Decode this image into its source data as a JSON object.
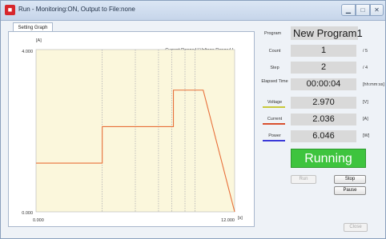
{
  "window": {
    "title": "Run - Monitoring:ON, Output to File:none",
    "icon": "app-red-icon"
  },
  "tab": {
    "label": "Setting Graph"
  },
  "graph": {
    "y_unit": "[A]",
    "y_max_label": "4.000",
    "y_min_label": "0.000",
    "x_min_label": "0.000",
    "x_max_label": "12.000",
    "x_unit": "[s]",
    "range_label": "Current Range:H,Voltage Range:H",
    "line_color": "#e8703a",
    "step_boundaries": [
      4.0,
      6.0,
      7.4,
      8.2,
      9.0,
      9.6
    ],
    "series": [
      {
        "x": [
          0,
          4.0,
          4.0,
          8.3,
          8.3,
          10.1,
          12.0
        ],
        "y": [
          1.2,
          1.2,
          2.1,
          2.1,
          3.0,
          3.0,
          0
        ]
      }
    ],
    "x_range": [
      0,
      12
    ],
    "y_range": [
      0,
      4
    ]
  },
  "status": {
    "program_label": "Program",
    "program_name": "New Program1",
    "count_label": "Count",
    "count_value": "1",
    "count_total": "/ 5",
    "step_label": "Step",
    "step_value": "2",
    "step_total": "/ 4",
    "elapsed_label": "Elapsed Time",
    "elapsed_value": "00:00:04",
    "elapsed_unit": "[hh:mm:ss]",
    "voltage_label": "Voltage",
    "voltage_value": "2.970",
    "voltage_unit": "[V]",
    "voltage_color": "#c9c93a",
    "current_label": "Current",
    "current_value": "2.036",
    "current_unit": "[A]",
    "current_color": "#d9502f",
    "power_label": "Power",
    "power_value": "6.046",
    "power_unit": "[W]",
    "power_color": "#3a3ad9",
    "running_text": "Running",
    "running_color": "#3ec43e"
  },
  "buttons": {
    "run": "Run",
    "stop": "Stop",
    "pause": "Pause",
    "close": "Close"
  }
}
